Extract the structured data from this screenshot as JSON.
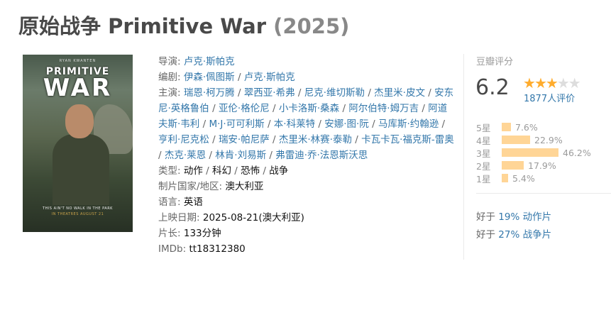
{
  "title": {
    "name": "原始战争 Primitive War",
    "year": "(2025)"
  },
  "poster": {
    "actor": "RYAN KWANTEN",
    "title_line1": "PRIMITIVE",
    "title_line2": "WAR",
    "tagline": "THIS AIN'T NO WALK IN THE PARK",
    "release": "IN THEATRES AUGUST 21"
  },
  "info": {
    "director_label": "导演:",
    "director": "卢克·斯帕克",
    "writer_label": "编剧:",
    "writers": [
      "伊森·佩图斯",
      "卢克·斯帕克"
    ],
    "cast_label": "主演:",
    "cast": [
      "瑞恩·柯万腾",
      "翠西亚·希弗",
      "尼克·维切斯勒",
      "杰里米·皮文",
      "安东尼·英格鲁伯",
      "亚伦·格伦尼",
      "小卡洛斯·桑森",
      "阿尔伯特·姆万吉",
      "阿道夫斯·韦利",
      "M·J·可可利斯",
      "本·科莱特",
      "安娜·图·阮",
      "马库斯·约翰逊",
      "亨利·尼克松",
      "瑞安·帕尼萨",
      "杰里米·林赛·泰勒",
      "卡瓦卡瓦·福克斯-雷奥",
      "杰克·莱恩",
      "林肯·刘易斯",
      "弗雷迪·乔·法恩斯沃思"
    ],
    "genre_label": "类型:",
    "genres": [
      "动作",
      "科幻",
      "恐怖",
      "战争"
    ],
    "country_label": "制片国家/地区:",
    "country": "澳大利亚",
    "language_label": "语言:",
    "language": "英语",
    "release_label": "上映日期:",
    "release": "2025-08-21(澳大利亚)",
    "runtime_label": "片长:",
    "runtime": "133分钟",
    "imdb_label": "IMDb:",
    "imdb": "tt18312380"
  },
  "rating": {
    "label": "豆瓣评分",
    "score": "6.2",
    "stars_filled": 3,
    "votes": "1877人评价",
    "distribution": [
      {
        "label": "5星",
        "pct": "7.6%",
        "value": 7.6
      },
      {
        "label": "4星",
        "pct": "22.9%",
        "value": 22.9
      },
      {
        "label": "3星",
        "pct": "46.2%",
        "value": 46.2
      },
      {
        "label": "2星",
        "pct": "17.9%",
        "value": 17.9
      },
      {
        "label": "1星",
        "pct": "5.4%",
        "value": 5.4
      }
    ],
    "better_than": [
      {
        "prefix": "好于",
        "value": "19% 动作片"
      },
      {
        "prefix": "好于",
        "value": "27% 战争片"
      }
    ]
  },
  "colors": {
    "link": "#3377aa",
    "star": "#ffac2d",
    "bar": "#ffd596"
  }
}
